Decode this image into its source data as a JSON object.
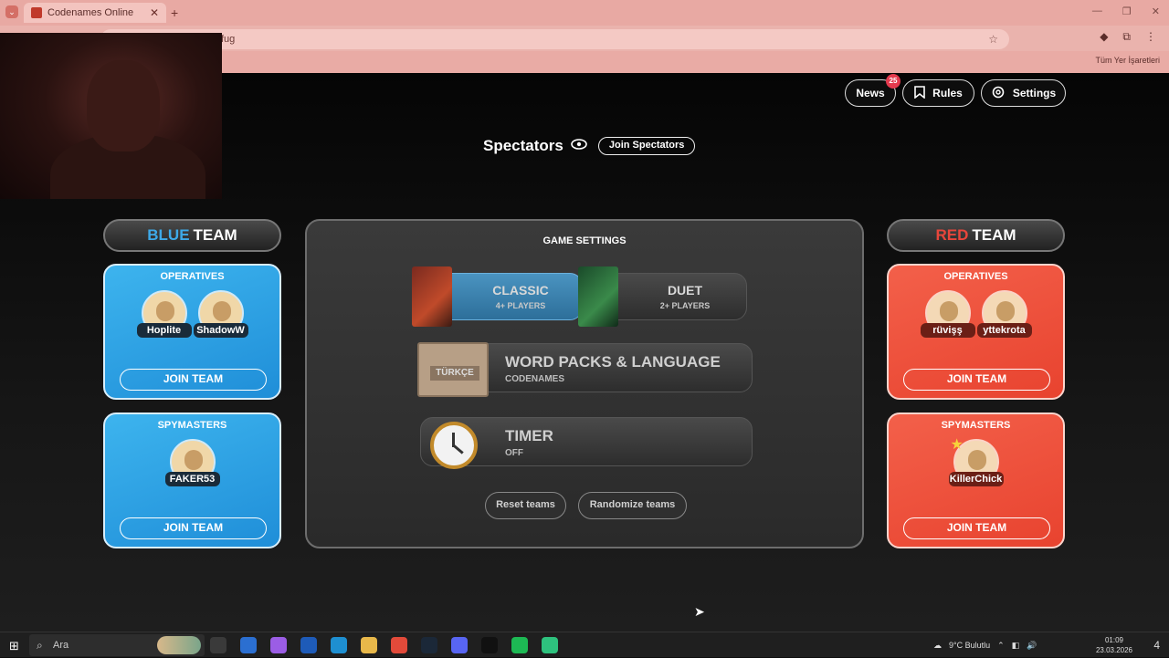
{
  "browser": {
    "tab_title": "Codenames Online",
    "url_fragment": "fug",
    "bookmarks_label": "Tüm Yer İşaretleri"
  },
  "header": {
    "news_label": "News",
    "news_badge": "25",
    "rules_label": "Rules",
    "settings_label": "Settings"
  },
  "spectators": {
    "title": "Spectators",
    "join_label": "Join Spectators"
  },
  "blue_team": {
    "color_word": "BLUE",
    "team_word": "TEAM",
    "operatives_title": "OPERATIVES",
    "operatives": [
      "Hoplite",
      "ShadowW"
    ],
    "spymasters_title": "SPYMASTERS",
    "spymasters": [
      "FAKER53"
    ],
    "join_label": "JOIN TEAM"
  },
  "red_team": {
    "color_word": "RED",
    "team_word": "TEAM",
    "operatives_title": "OPERATIVES",
    "operatives": [
      "rüvişş",
      "yttekrota"
    ],
    "spymasters_title": "SPYMASTERS",
    "spymasters": [
      "KillerChick"
    ],
    "join_label": "JOIN TEAM"
  },
  "game_settings": {
    "title": "GAME SETTINGS",
    "modes": [
      {
        "name": "CLASSIC",
        "sub": "4+ PLAYERS",
        "selected": true
      },
      {
        "name": "DUET",
        "sub": "2+ PLAYERS",
        "selected": false
      }
    ],
    "wordpacks": {
      "name": "WORD PACKS & LANGUAGE",
      "sub": "CODENAMES",
      "box_label": "TÜRKÇE"
    },
    "timer": {
      "name": "TIMER",
      "sub": "OFF"
    },
    "reset_label": "Reset teams",
    "randomize_label": "Randomize teams"
  },
  "taskbar": {
    "search_placeholder": "Ara",
    "weather": "9°C  Bulutlu",
    "time": "01:09",
    "date": "23.03.2026",
    "notifications": "4"
  },
  "colors": {
    "blue_accent": "#3ea9e8",
    "red_accent": "#e8463b",
    "badge": "#e43a4e"
  }
}
